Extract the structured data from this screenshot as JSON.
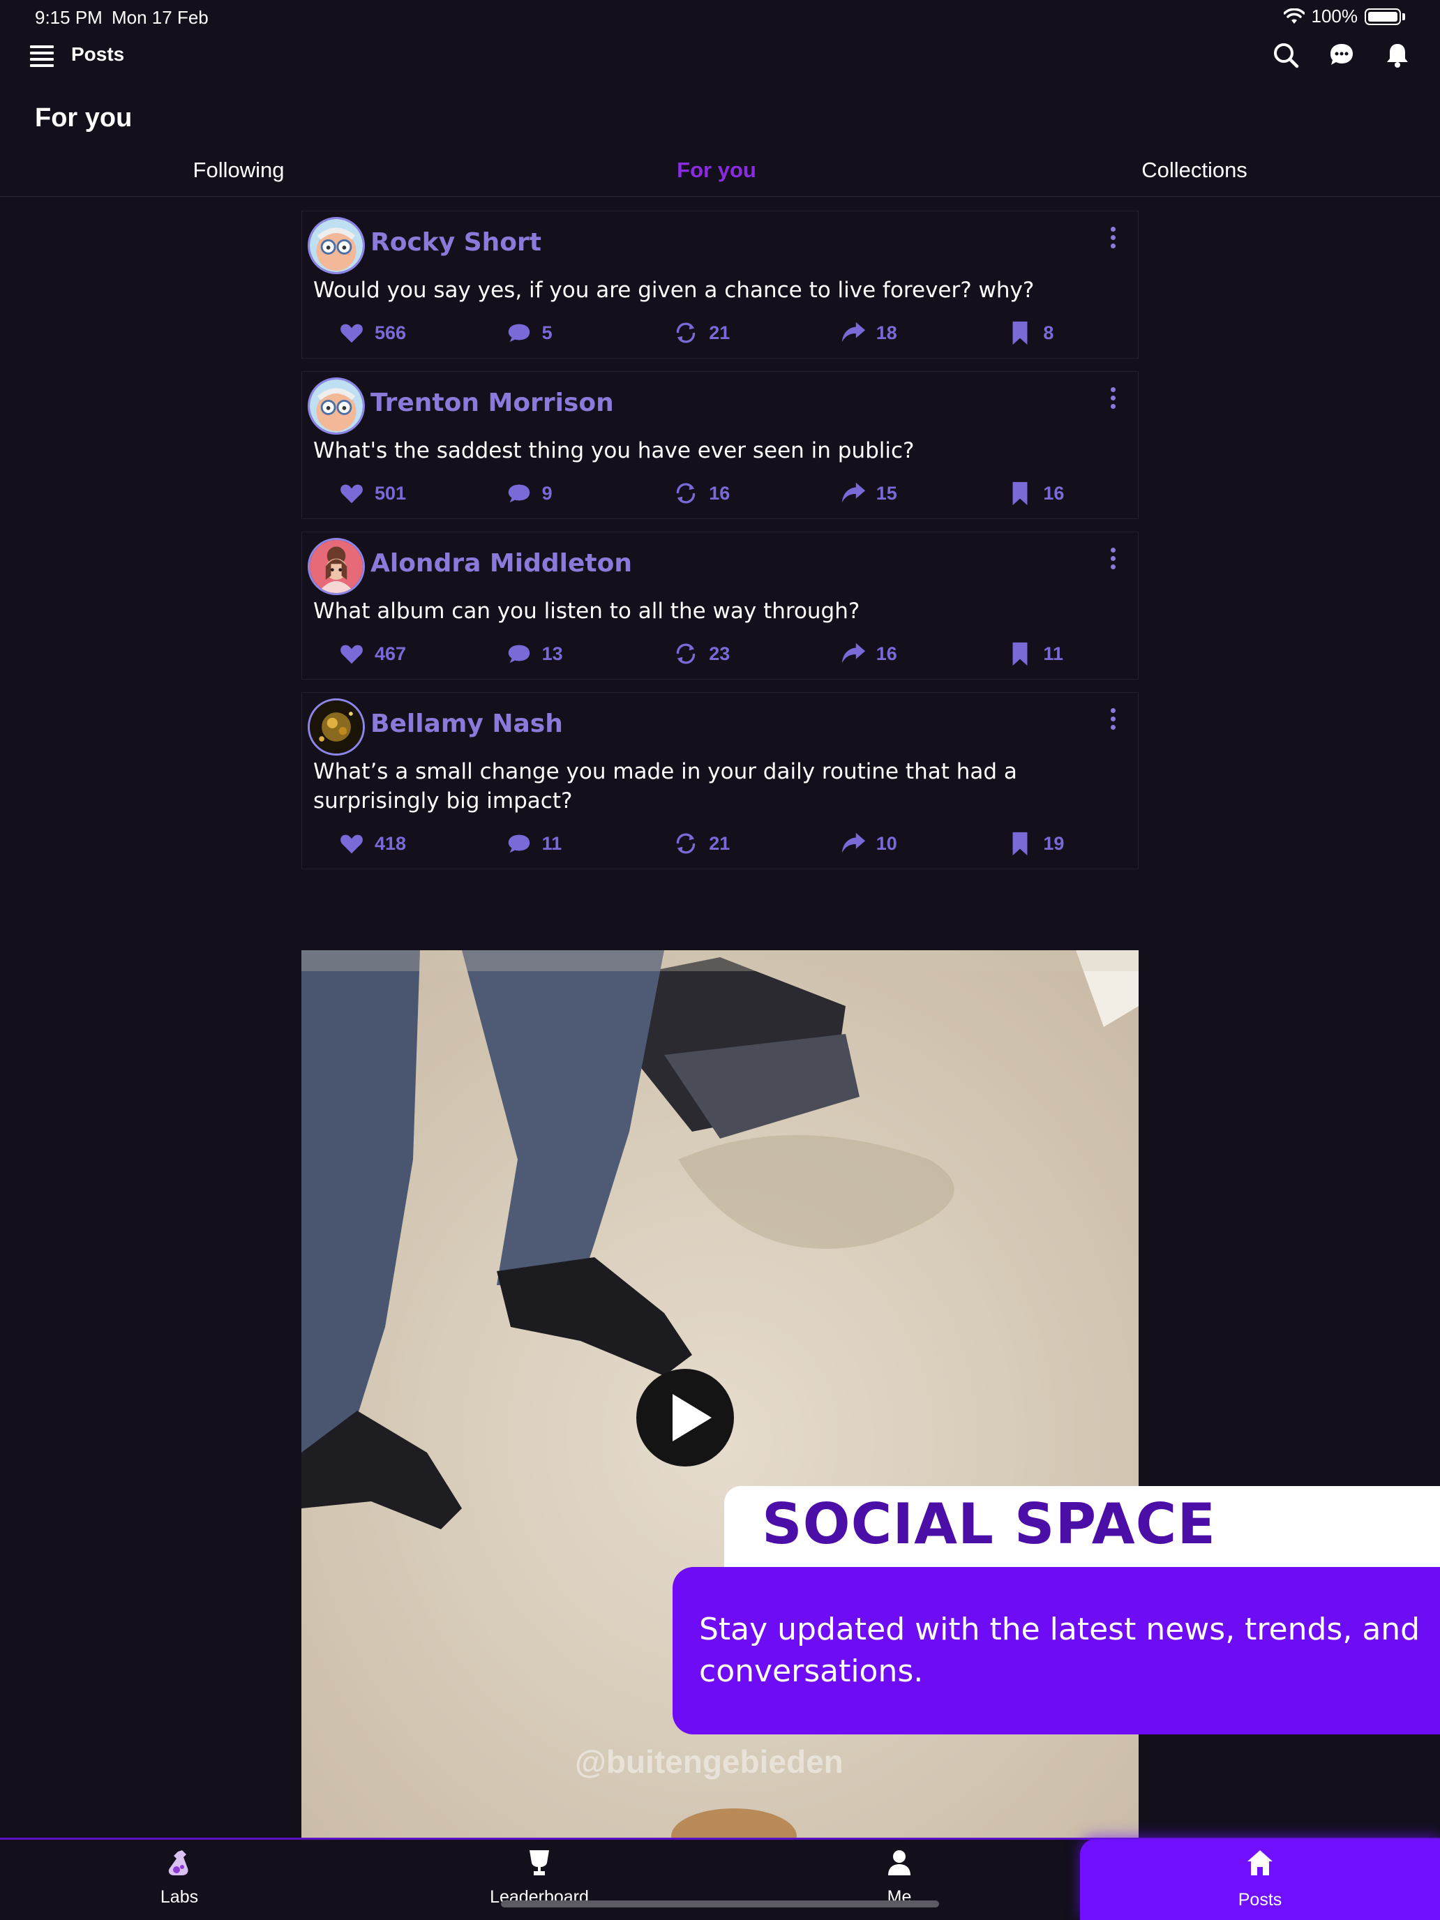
{
  "status_bar": {
    "time": "9:15 PM",
    "date": "Mon 17 Feb",
    "battery": "100%"
  },
  "app_bar": {
    "title": "Posts"
  },
  "page_title": "For you",
  "tabs": [
    {
      "label": "Following",
      "active": false
    },
    {
      "label": "For you",
      "active": true
    },
    {
      "label": "Collections",
      "active": false
    }
  ],
  "posts": [
    {
      "author": "Rocky Short",
      "text": "Would you say yes, if you are given a chance to live forever? why?",
      "likes": "566",
      "comments": "5",
      "reposts": "21",
      "shares": "18",
      "bookmarks": "8"
    },
    {
      "author": "Trenton Morrison",
      "text": "What's the saddest thing you have ever seen in public?",
      "likes": "501",
      "comments": "9",
      "reposts": "16",
      "shares": "15",
      "bookmarks": "16"
    },
    {
      "author": "Alondra Middleton",
      "text": "What album can you listen to all the way through?",
      "likes": "467",
      "comments": "13",
      "reposts": "23",
      "shares": "16",
      "bookmarks": "11"
    },
    {
      "author": "Bellamy Nash",
      "text": "What’s a small change you made in your daily routine that had a surprisingly big impact?",
      "likes": "418",
      "comments": "11",
      "reposts": "21",
      "shares": "10",
      "bookmarks": "19"
    }
  ],
  "video": {
    "watermark": "@buitengebieden"
  },
  "promo": {
    "title": "SOCIAL SPACE",
    "body": "Stay updated with the latest news, trends, and conversations."
  },
  "bottom_nav": [
    {
      "label": "Labs",
      "icon": "flask-icon"
    },
    {
      "label": "Leaderboard",
      "icon": "trophy-icon"
    },
    {
      "label": "Me",
      "icon": "person-icon"
    },
    {
      "label": "Posts",
      "icon": "home-icon"
    }
  ],
  "colors": {
    "accent": "#7010ff",
    "author": "#8b7ad9",
    "action": "#7a6ad8",
    "background": "#13101c"
  }
}
